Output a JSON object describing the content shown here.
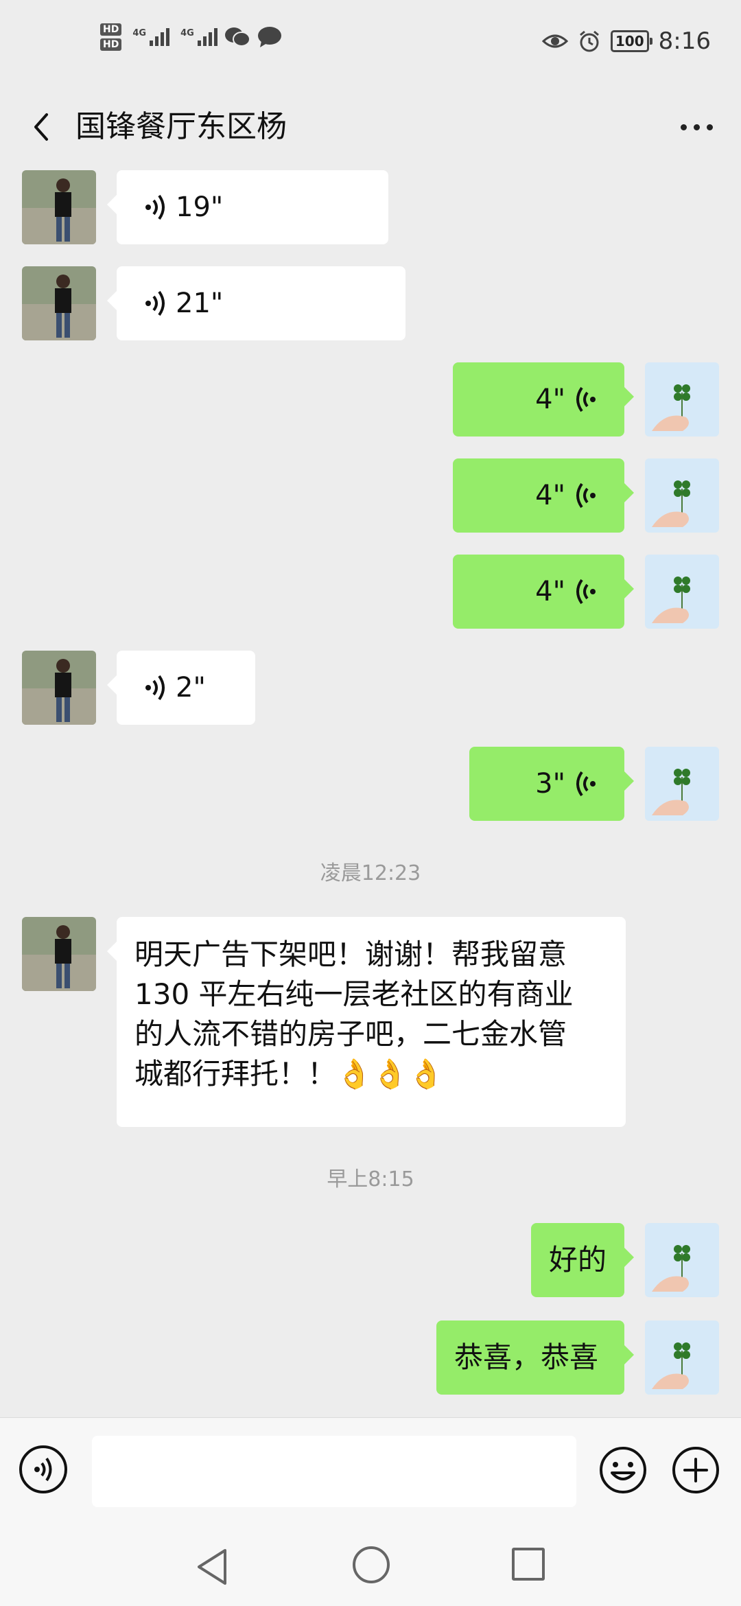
{
  "status_bar": {
    "hd1": "HD",
    "hd2": "HD",
    "net1": "4G",
    "net2": "4G",
    "battery": "100",
    "time": "8:16"
  },
  "header": {
    "title": "国锋餐厅东区杨"
  },
  "messages": [
    {
      "type": "voice",
      "side": "in",
      "duration": "19\""
    },
    {
      "type": "voice",
      "side": "in",
      "duration": "21\""
    },
    {
      "type": "voice",
      "side": "out",
      "duration": "4\""
    },
    {
      "type": "voice",
      "side": "out",
      "duration": "4\""
    },
    {
      "type": "voice",
      "side": "out",
      "duration": "4\""
    },
    {
      "type": "voice",
      "side": "in",
      "duration": "2\""
    },
    {
      "type": "voice",
      "side": "out",
      "duration": "3\""
    },
    {
      "type": "time",
      "text": "凌晨12:23"
    },
    {
      "type": "text",
      "side": "in",
      "lines": [
        "明天广告下架吧！谢谢！帮我留意",
        "130 平左右纯一层老社区的有商业",
        "的人流不错的房子吧，二七金水管",
        "城都行拜托！！👌👌👌"
      ]
    },
    {
      "type": "time",
      "text": "早上8:15"
    },
    {
      "type": "text",
      "side": "out",
      "text": "好的"
    },
    {
      "type": "text",
      "side": "out",
      "text": "恭喜，恭喜"
    }
  ],
  "input": {
    "placeholder": ""
  },
  "colors": {
    "background": "#ededed",
    "out_bubble": "#95ec69",
    "in_bubble": "#ffffff"
  }
}
